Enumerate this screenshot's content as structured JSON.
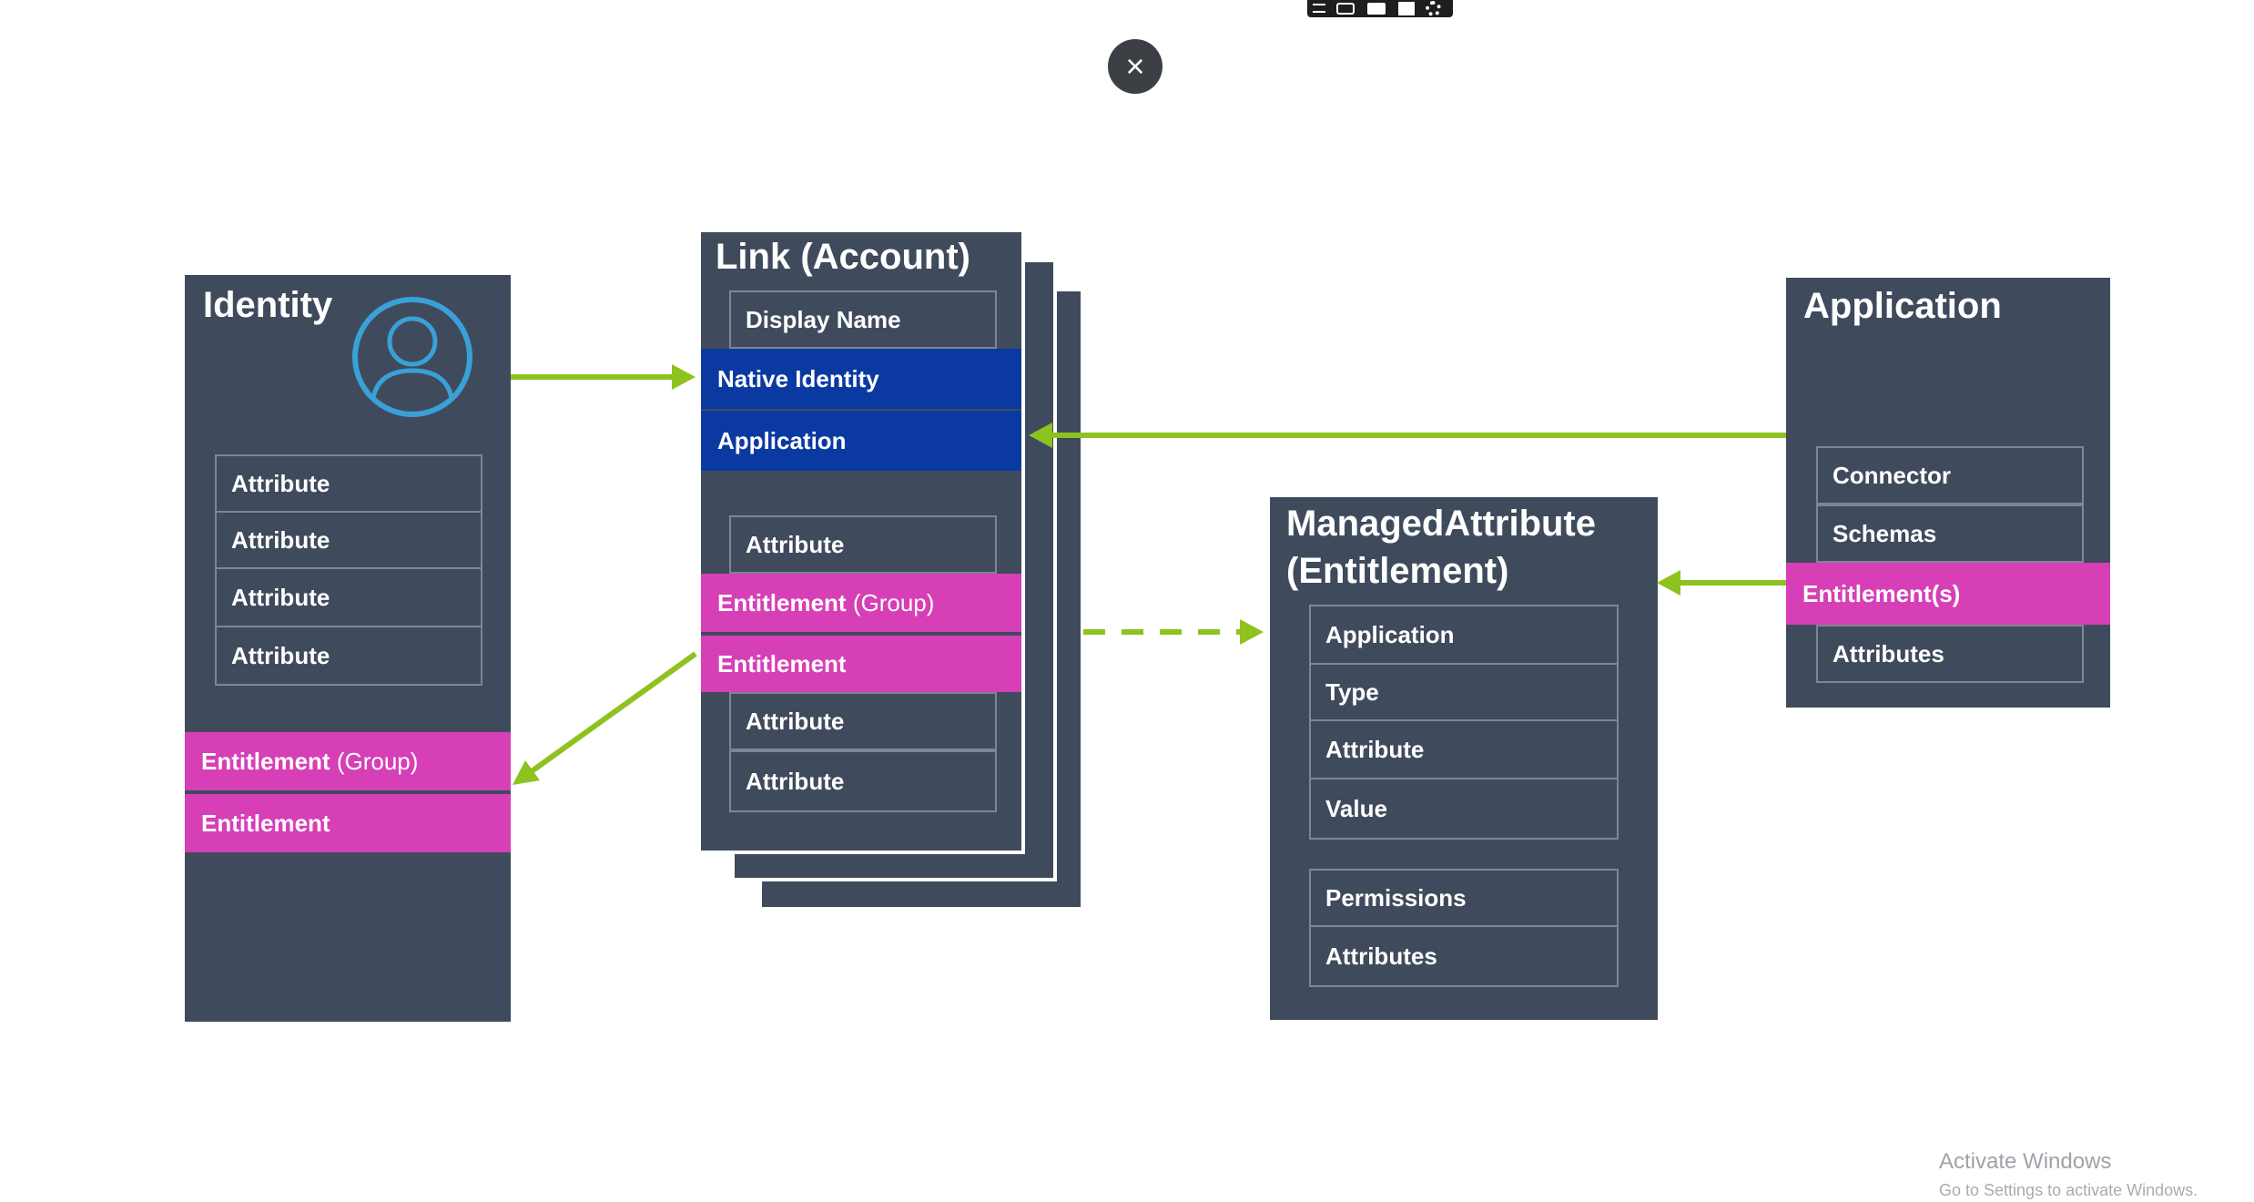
{
  "close_glyph": "×",
  "identity": {
    "title": "Identity",
    "attributes": [
      "Attribute",
      "Attribute",
      "Attribute",
      "Attribute"
    ],
    "entitlement_group": {
      "main": "Entitlement",
      "suffix": "(Group)"
    },
    "entitlement": "Entitlement"
  },
  "link": {
    "title": "Link (Account)",
    "display_name": "Display Name",
    "native_identity": "Native Identity",
    "application": "Application",
    "attribute_1": "Attribute",
    "entitlement_group": {
      "main": "Entitlement",
      "suffix": "(Group)"
    },
    "entitlement": "Entitlement",
    "attribute_2": "Attribute",
    "attribute_3": "Attribute"
  },
  "managed_attribute": {
    "title_line1": "ManagedAttribute",
    "title_line2": "(Entitlement)",
    "fields": [
      "Application",
      "Type",
      "Attribute",
      "Value"
    ],
    "extra_fields": [
      "Permissions",
      "Attributes"
    ]
  },
  "application": {
    "title": "Application",
    "connector": "Connector",
    "schemas": "Schemas",
    "entitlements": "Entitlement(s)",
    "attributes": "Attributes"
  },
  "watermark": {
    "line1": "Activate Windows",
    "line2": "Go to Settings to activate Windows."
  },
  "colors": {
    "panel": "#3f4b5c",
    "entitlement": "#d63fb6",
    "link_key": "#0a3aa1",
    "arrow": "#8dc21f",
    "icon": "#3aa0d8"
  }
}
